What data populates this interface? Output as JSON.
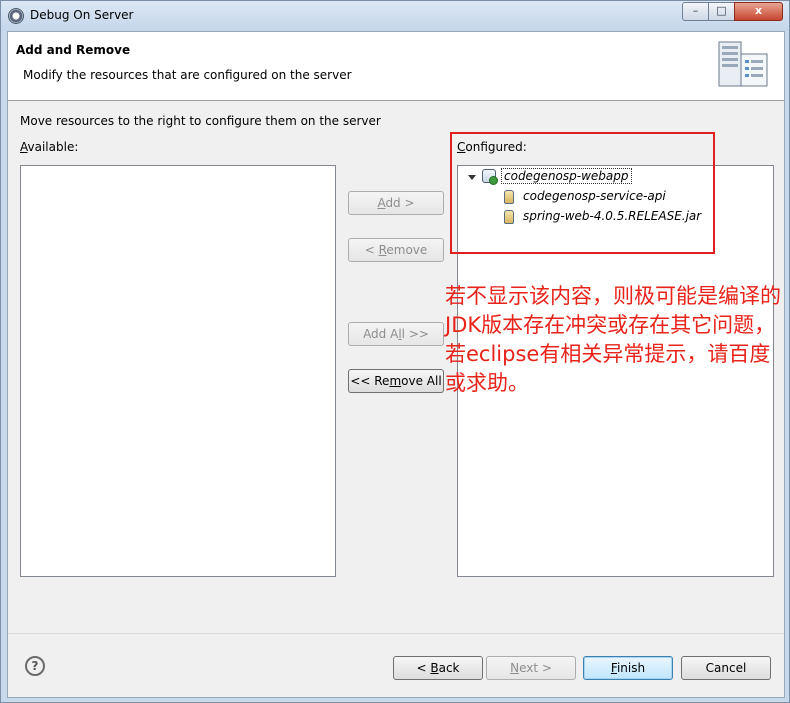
{
  "window": {
    "title": "Debug On Server",
    "controls": {
      "minimize": "–",
      "maximize": "□",
      "close": "x"
    }
  },
  "header": {
    "title": "Add and Remove",
    "description": "Modify the resources that are configured on the server",
    "icon": "server-icon"
  },
  "instruction": "Move resources to the right to configure them on the server",
  "available": {
    "label_mnemonic": "A",
    "label_rest": "vailable:",
    "items": []
  },
  "configured": {
    "label_mnemonic": "C",
    "label_rest": "onfigured:",
    "tree": {
      "root": "codegenosp-webapp",
      "children": [
        "codegenosp-service-api",
        "spring-web-4.0.5.RELEASE.jar"
      ]
    }
  },
  "buttons": {
    "add_pre": "",
    "add_mnemonic": "A",
    "add_post": "dd >",
    "remove_pre": "< ",
    "remove_mnemonic": "R",
    "remove_post": "emove",
    "addall_pre": "Add A",
    "addall_mnemonic": "l",
    "addall_post": "l >>",
    "removeall_pre": "<< Re",
    "removeall_mnemonic": "m",
    "removeall_post": "ove All"
  },
  "footer": {
    "help": "?",
    "back_pre": "< ",
    "back_mnemonic": "B",
    "back_post": "ack",
    "next_pre": "",
    "next_mnemonic": "N",
    "next_post": "ext >",
    "finish_pre": "",
    "finish_mnemonic": "F",
    "finish_post": "inish",
    "cancel": "Cancel"
  },
  "annotation": {
    "text": "若不显示该内容，则极可能是编译的JDK版本存在冲突或存在其它问题，若eclipse有相关异常提示，请百度或求助。",
    "color": "#e8231a"
  }
}
